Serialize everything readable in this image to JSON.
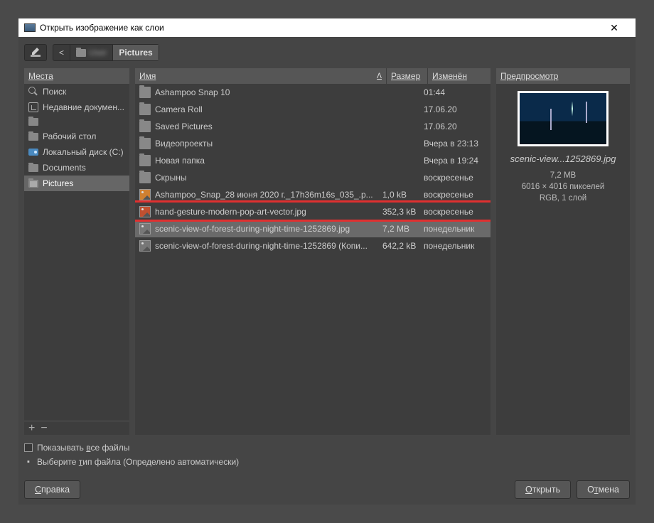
{
  "title": "Открыть изображение как слои",
  "breadcrumb": {
    "current": "Pictures"
  },
  "sidebar": {
    "header": "Места",
    "items": [
      {
        "label": "Поиск",
        "icon": "search"
      },
      {
        "label": "Недавние докумен...",
        "icon": "recent"
      },
      {
        "label": " ",
        "icon": "folder"
      },
      {
        "label": "Рабочий стол",
        "icon": "folder"
      },
      {
        "label": "Локальный диск (C:)",
        "icon": "disk"
      },
      {
        "label": "Documents",
        "icon": "folder"
      },
      {
        "label": "Pictures",
        "icon": "folder-open",
        "selected": true
      }
    ]
  },
  "columns": {
    "name": "Имя",
    "size": "Размер",
    "modified": "Изменён"
  },
  "files": [
    {
      "name": "Ashampoo Snap 10",
      "size": "",
      "modified": "01:44",
      "type": "folder"
    },
    {
      "name": "Camera Roll",
      "size": "",
      "modified": "17.06.20",
      "type": "folder"
    },
    {
      "name": "Saved Pictures",
      "size": "",
      "modified": "17.06.20",
      "type": "folder"
    },
    {
      "name": "Видеопроекты",
      "size": "",
      "modified": "Вчера в 23:13",
      "type": "folder"
    },
    {
      "name": "Новая папка",
      "size": "",
      "modified": "Вчера в 19:24",
      "type": "folder"
    },
    {
      "name": "Скрыны",
      "size": "",
      "modified": "воскресенье",
      "type": "folder"
    },
    {
      "name": "Ashampoo_Snap_28 июня 2020 г._17h36m16s_035_.p...",
      "size": "1,0 kB",
      "modified": "воскресенье",
      "type": "image-color2"
    },
    {
      "name": "hand-gesture-modern-pop-art-vector.jpg",
      "size": "352,3 kB",
      "modified": "воскресенье",
      "type": "image-color",
      "highlighted": true
    },
    {
      "name": "scenic-view-of-forest-during-night-time-1252869.jpg",
      "size": "7,2 MB",
      "modified": "понедельник",
      "type": "image",
      "selected": true
    },
    {
      "name": "scenic-view-of-forest-during-night-time-1252869 (Копи...",
      "size": "642,2 kB",
      "modified": "понедельник",
      "type": "image"
    }
  ],
  "preview": {
    "header": "Предпросмотр",
    "filename": "scenic-view...1252869.jpg",
    "meta1": "7,2 MB",
    "meta2": "6016 × 4016 пикселей",
    "meta3": "RGB, 1 слой"
  },
  "options": {
    "show_all_pre": "Показывать ",
    "show_all_u": "в",
    "show_all_post": "се файлы",
    "filetype_pre": "Выберите ",
    "filetype_u": "т",
    "filetype_post": "ип файла (Определено автоматически)"
  },
  "buttons": {
    "help_u": "С",
    "help_post": "правка",
    "open_u": "О",
    "open_post": "ткрыть",
    "cancel_pre": "О",
    "cancel_u": "т",
    "cancel_post": "мена"
  }
}
